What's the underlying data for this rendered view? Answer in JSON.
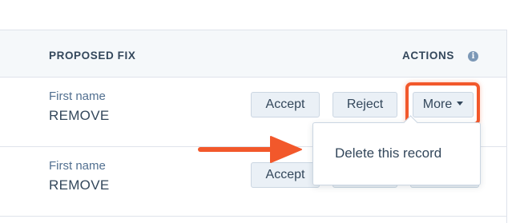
{
  "table": {
    "columns": {
      "proposed_fix": "PROPOSED FIX",
      "actions": "ACTIONS"
    },
    "rows": [
      {
        "field": "First name",
        "value": "REMOVE",
        "accept": "Accept",
        "reject": "Reject",
        "more": "More"
      },
      {
        "field": "First name",
        "value": "REMOVE",
        "accept": "Accept"
      }
    ]
  },
  "dropdown": {
    "items": [
      "Delete this record"
    ]
  },
  "colors": {
    "highlight": "#f2582b",
    "button_bg": "#eaf0f6",
    "header_bg": "#f5f8fa"
  },
  "icons": {
    "actions_info": "info-icon",
    "more_caret": "caret-down-icon",
    "callout": "arrow-right-icon"
  }
}
